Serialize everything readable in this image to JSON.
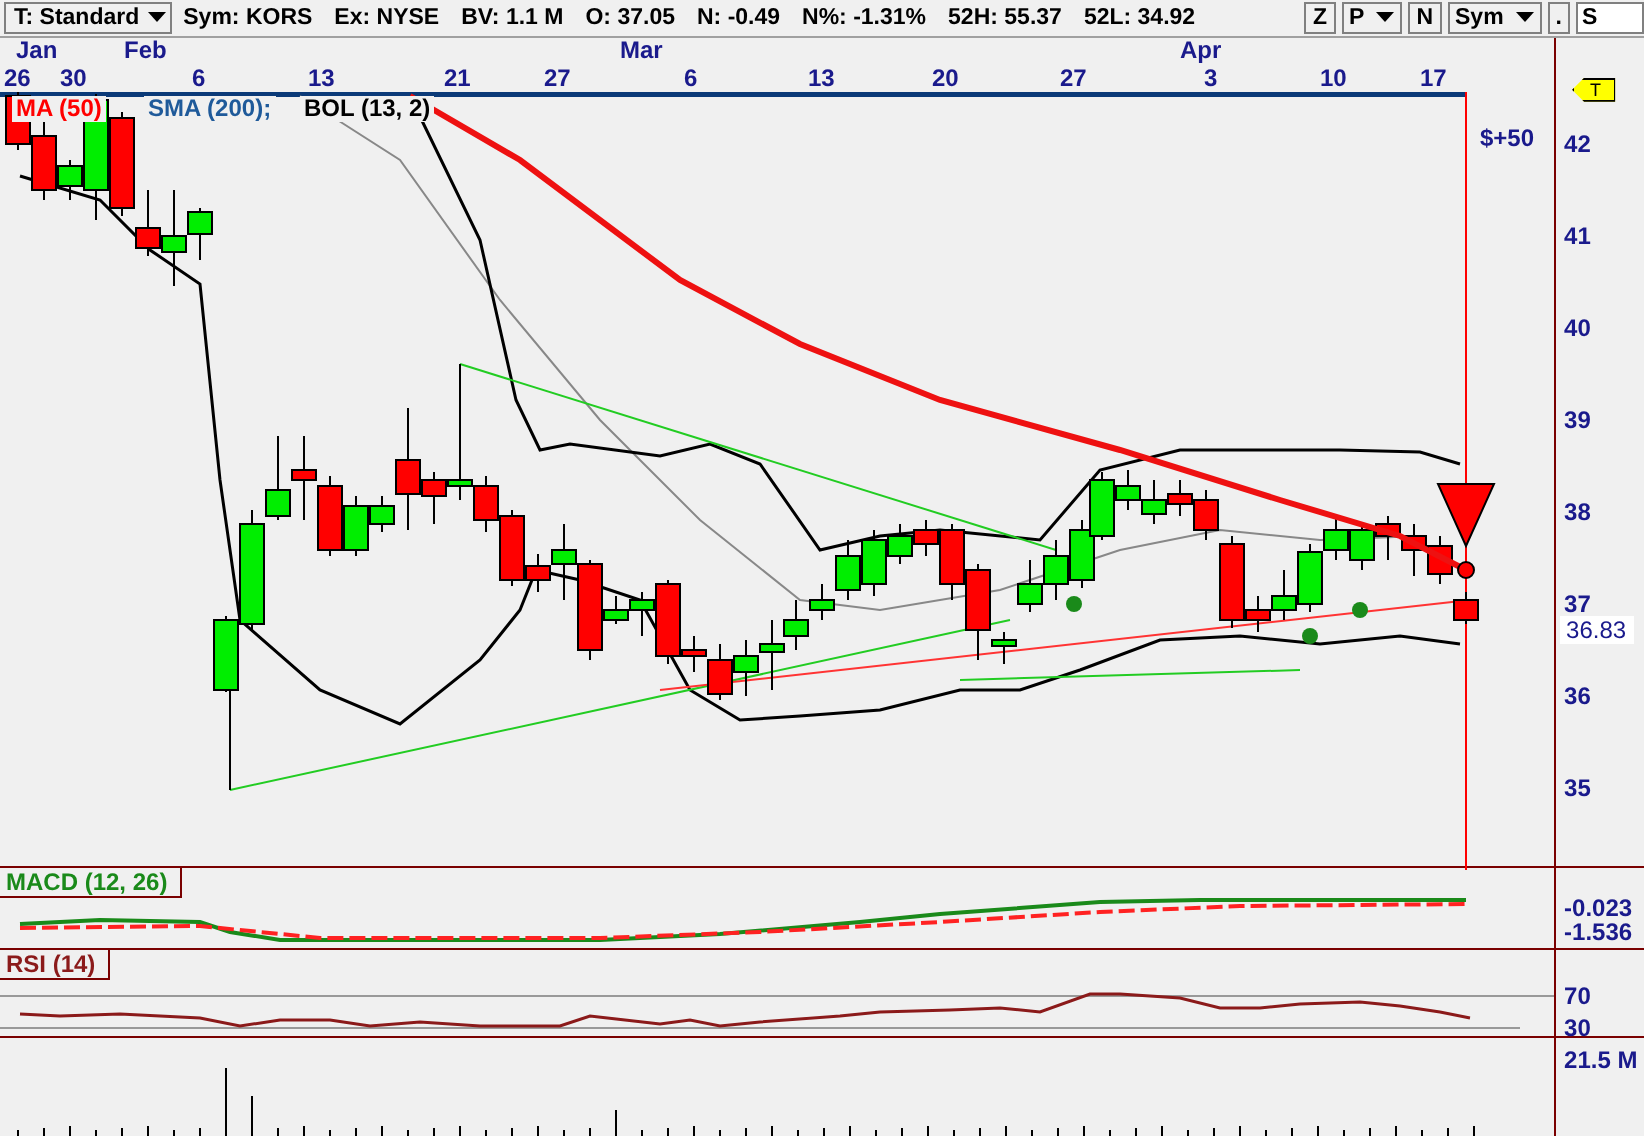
{
  "toolbar": {
    "template": {
      "label": "T: Standard"
    },
    "quote": [
      "Sym: KORS",
      "Ex: NYSE",
      "BV: 1.1 M",
      "O: 37.05",
      "N: -0.49",
      "N%: -1.31%",
      "52H: 55.37",
      "52L: 34.92"
    ],
    "buttons": [
      {
        "label": "Z",
        "kind": "button"
      },
      {
        "label": "P",
        "kind": "dropdown"
      },
      {
        "label": "N",
        "kind": "button"
      },
      {
        "label": "Sym",
        "kind": "dropdown"
      },
      {
        "label": ".",
        "kind": "button"
      }
    ],
    "symbol_field": {
      "value": "S"
    }
  },
  "date_axis": {
    "months": [
      "Jan",
      "Feb",
      "Mar",
      "Apr"
    ],
    "days": [
      "26",
      "30",
      "6",
      "13",
      "21",
      "27",
      "6",
      "13",
      "20",
      "27",
      "3",
      "10",
      "17"
    ]
  },
  "price_chart": {
    "legend": [
      {
        "label": "MA (50)",
        "color": "#ff0000"
      },
      {
        "label": "SMA (200);",
        "color": "#1f5a9a"
      },
      {
        "label": "BOL (13, 2)",
        "color": "#000000"
      }
    ],
    "y_ticks": [
      "42",
      "41",
      "40",
      "39",
      "38",
      "37",
      "36",
      "35"
    ],
    "last_price": "36.83",
    "profit_label": "$+50",
    "marker_badge": "T"
  },
  "macd": {
    "title": "MACD (12, 26)",
    "readings": [
      "-0.023",
      "-1.536"
    ]
  },
  "rsi": {
    "title": "RSI (14)",
    "ticks": [
      "70",
      "30"
    ]
  },
  "volume": {
    "reading": "21.5 M"
  }
}
